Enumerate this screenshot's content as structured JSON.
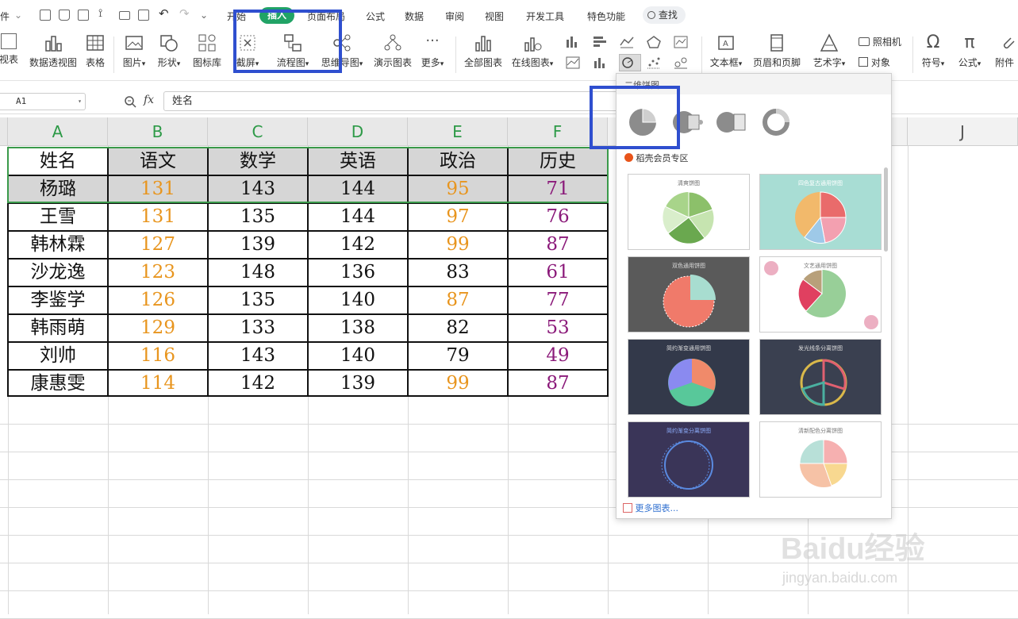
{
  "menubar": {
    "file_partial": "件",
    "tabs": [
      "开始",
      "插入",
      "页面布局",
      "公式",
      "数据",
      "审阅",
      "视图",
      "开发工具",
      "特色功能"
    ],
    "search": "查找"
  },
  "ribbon": {
    "pivot_table_partial": "视表",
    "pivot_chart": "数据透视图",
    "table": "表格",
    "picture": "图片",
    "shape": "形状",
    "icon_lib": "图标库",
    "screenshot_partial": "截屏",
    "flowchart": "流程图",
    "mindmap": "思维导图",
    "demo_chart": "演示图表",
    "more": "更多",
    "all_charts": "全部图表",
    "online_charts": "在线图表",
    "textbox": "文本框",
    "header_footer": "页眉和页脚",
    "wordart": "艺术字",
    "camera": "照相机",
    "object": "对象",
    "symbol": "符号",
    "formula": "公式",
    "attachment_partial": "附件"
  },
  "formulabar": {
    "cell_ref": "A1",
    "fx": "fx",
    "content": "姓名"
  },
  "grid": {
    "columns": [
      "A",
      "B",
      "C",
      "D",
      "E",
      "F",
      "",
      "",
      "",
      "J"
    ],
    "headers": [
      "姓名",
      "语文",
      "数学",
      "英语",
      "政治",
      "历史"
    ],
    "rows": [
      [
        "杨璐",
        "131",
        "143",
        "144",
        "95",
        "71"
      ],
      [
        "王雪",
        "131",
        "135",
        "144",
        "97",
        "76"
      ],
      [
        "韩林霖",
        "127",
        "139",
        "142",
        "99",
        "87"
      ],
      [
        "沙龙逸",
        "123",
        "148",
        "136",
        "83",
        "61"
      ],
      [
        "李鉴学",
        "126",
        "135",
        "140",
        "87",
        "77"
      ],
      [
        "韩雨萌",
        "129",
        "133",
        "138",
        "82",
        "53"
      ],
      [
        "刘帅",
        "116",
        "143",
        "140",
        "79",
        "49"
      ],
      [
        "康惠雯",
        "114",
        "142",
        "139",
        "99",
        "87"
      ]
    ],
    "colors": {
      "chinese": "#e8951e",
      "politics_high": "#e8951e",
      "history": "#8b1a7a",
      "default": "#111111",
      "header_green": "#2d9a47"
    }
  },
  "chart_panel": {
    "section_title": "二维饼图",
    "member_zone": "稻壳会员专区",
    "more_charts": "更多图表...",
    "templates": [
      "清爽饼图",
      "四色复古通用饼图",
      "双色通用饼图",
      "文艺通用饼图",
      "简约渐变通用饼图",
      "发光线条分离饼图",
      "简约渐变分离饼图",
      "清新配色分离饼图"
    ]
  },
  "watermark": {
    "brand": "Baidu经验",
    "url": "jingyan.baidu.com"
  }
}
